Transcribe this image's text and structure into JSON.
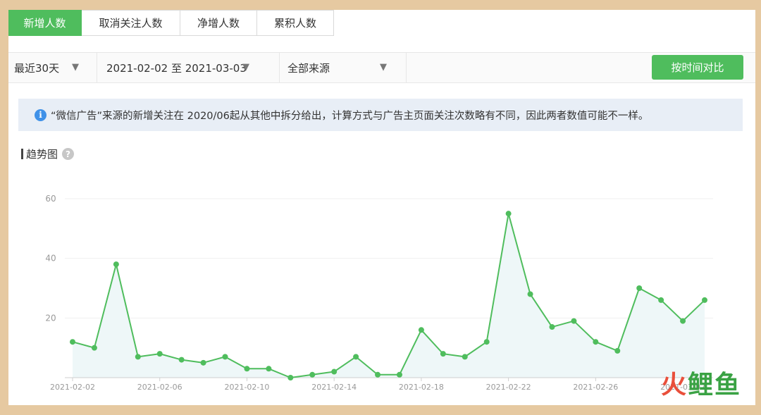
{
  "tabs": [
    {
      "label": "新增人数",
      "active": true
    },
    {
      "label": "取消关注人数",
      "active": false
    },
    {
      "label": "净增人数",
      "active": false
    },
    {
      "label": "累积人数",
      "active": false
    }
  ],
  "filters": {
    "range_select": "最近30天",
    "date_range": "2021-02-02 至 2021-03-03",
    "source_select": "全部来源",
    "caret_icon": "caret-down-icon"
  },
  "compare_button": "按时间对比",
  "notice": {
    "icon": "info-icon",
    "text": "“微信广告”来源的新增关注在 2020/06起从其他中拆分给出，计算方式与广告主页面关注次数略有不同，因此两者数值可能不一样。"
  },
  "section": {
    "title": "趋势图",
    "help_icon": "question-icon"
  },
  "watermark": {
    "part1": "火",
    "part2": "鲤鱼"
  },
  "colors": {
    "accent": "#4fbd5d",
    "line": "#4fbd5d",
    "area": "#eef7f8",
    "info": "#3f91e8",
    "notice_bg": "#e8eef6"
  },
  "chart_data": {
    "type": "line",
    "title": "",
    "xlabel": "",
    "ylabel": "",
    "x": [
      "2021-02-02",
      "2021-02-03",
      "2021-02-04",
      "2021-02-05",
      "2021-02-06",
      "2021-02-07",
      "2021-02-08",
      "2021-02-09",
      "2021-02-10",
      "2021-02-11",
      "2021-02-12",
      "2021-02-13",
      "2021-02-14",
      "2021-02-15",
      "2021-02-16",
      "2021-02-17",
      "2021-02-18",
      "2021-02-19",
      "2021-02-20",
      "2021-02-21",
      "2021-02-22",
      "2021-02-23",
      "2021-02-24",
      "2021-02-25",
      "2021-02-26",
      "2021-02-27",
      "2021-02-28",
      "2021-03-01",
      "2021-03-02",
      "2021-03-03"
    ],
    "values": [
      12,
      10,
      38,
      7,
      8,
      6,
      5,
      7,
      3,
      3,
      0,
      1,
      2,
      7,
      1,
      1,
      16,
      8,
      7,
      12,
      55,
      28,
      17,
      19,
      12,
      9,
      30,
      26,
      19,
      26
    ],
    "xticks": [
      "2021-02-02",
      "2021-02-06",
      "2021-02-10",
      "2021-02-14",
      "2021-02-18",
      "2021-02-22",
      "2021-02-26",
      "2021-03-02"
    ],
    "yticks": [
      20,
      40,
      60
    ],
    "ylim": [
      0,
      60
    ],
    "grid": true
  }
}
